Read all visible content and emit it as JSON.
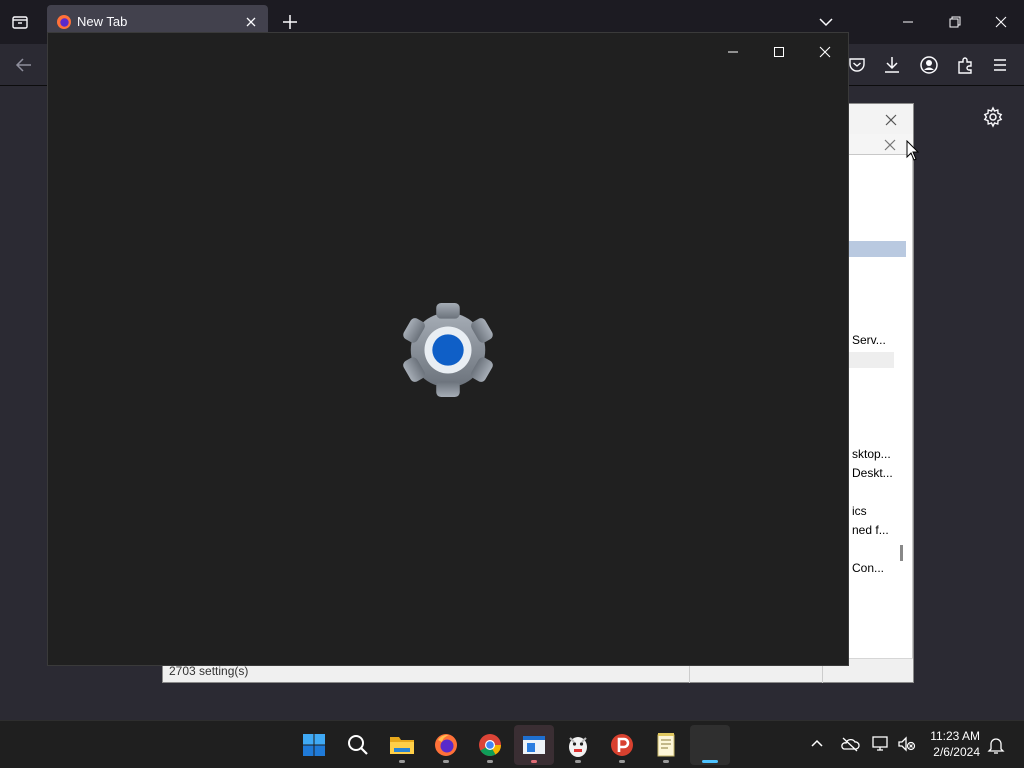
{
  "browser": {
    "tab_title": "New Tab",
    "window_controls": [
      "minimize",
      "restore",
      "close"
    ]
  },
  "background_dialog": {
    "rows": [
      "Serv...",
      "sktop...",
      "Deskt...",
      "ics",
      "ned f...",
      "Con..."
    ],
    "status_text": "2703 setting(s)"
  },
  "settings_window": {
    "app_icon": "settings-gear-icon",
    "accent_color": "#0f5fc7"
  },
  "taskbar": {
    "apps": [
      "start",
      "search",
      "file-explorer",
      "firefox",
      "chrome",
      "active-window",
      "app-mascot",
      "app-p",
      "notepad",
      "active-blank"
    ],
    "time": "11:23 AM",
    "date": "2/6/2024"
  }
}
